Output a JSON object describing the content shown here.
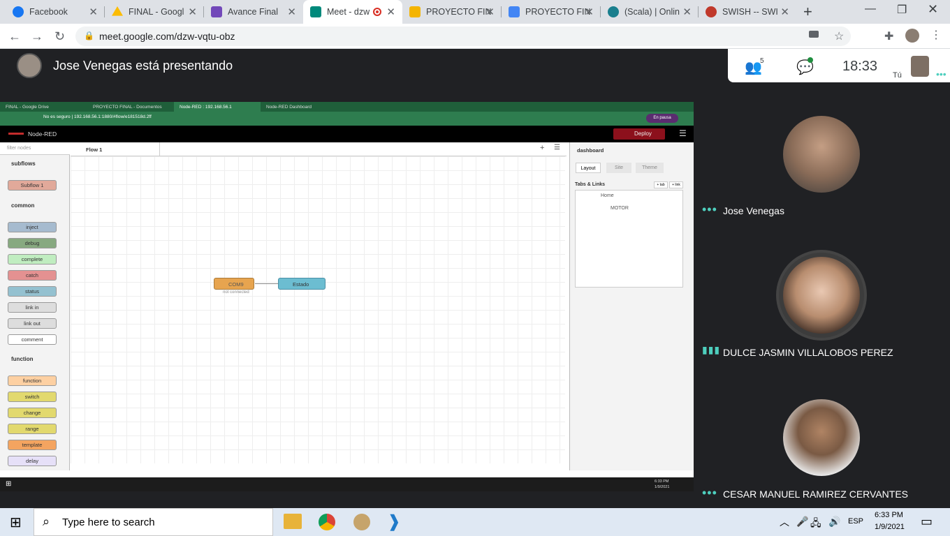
{
  "browser": {
    "tabs": [
      {
        "title": "Facebook",
        "color": "#1877f2"
      },
      {
        "title": "FINAL - Googl",
        "color": "#fbbc04"
      },
      {
        "title": "Avance Final",
        "color": "#7248b9"
      },
      {
        "title": "Meet - dzw",
        "color": "#00897b"
      },
      {
        "title": "PROYECTO FIN",
        "color": "#f4b400"
      },
      {
        "title": "PROYECTO FIN",
        "color": "#4285f4"
      },
      {
        "title": "(Scala) | Onlin",
        "color": "#1a7f8e"
      },
      {
        "title": "SWISH -- SWI",
        "color": "#c0392b"
      }
    ],
    "url": "meet.google.com/dzw-vqtu-obz"
  },
  "meet": {
    "presenting_text": "Jose Venegas está presentando",
    "participant_count": "5",
    "time": "18:33",
    "self_label": "Tú",
    "participants": [
      {
        "name": "Jose Venegas"
      },
      {
        "name": "DULCE JASMIN VILLALOBOS PEREZ"
      },
      {
        "name": "CESAR MANUEL RAMIREZ CERVANTES"
      }
    ]
  },
  "shared": {
    "tabs": [
      "FINAL - Google Drive",
      "PROYECTO FINAL - Documentos",
      "Node-RED : 192.168.56.1",
      "Node-RED Dashboard"
    ],
    "address": "No es seguro  |  192.168.56.1:1880/#flow/e181518d.2ff",
    "paused": "En pausa",
    "app_title": "Node-RED",
    "deploy": "Deploy",
    "filter_placeholder": "filter nodes",
    "flow_tab": "Flow 1",
    "categories": {
      "subflows": "subflows",
      "common": "common",
      "function": "function"
    },
    "palette": {
      "subflows": [
        "Subflow 1"
      ],
      "common": [
        "inject",
        "debug",
        "complete",
        "catch",
        "status",
        "link in",
        "link out",
        "comment"
      ],
      "function": [
        "function",
        "switch",
        "change",
        "range",
        "template",
        "delay"
      ]
    },
    "flow_nodes": {
      "com": "COM9",
      "com_status": "not connected",
      "estado": "Estado",
      "estado_badge": "abc"
    },
    "sidebar": {
      "title": "dashboard",
      "tabs": [
        "Layout",
        "Site",
        "Theme"
      ],
      "section": "Tabs & Links",
      "buttons": [
        "+ tab",
        "+ link"
      ],
      "tree": [
        "Home",
        "MOTOR"
      ]
    },
    "clock_time": "6:33 PM",
    "clock_date": "1/9/2021"
  },
  "taskbar": {
    "search_placeholder": "Type here to search",
    "lang": "ESP",
    "time": "6:33 PM",
    "date": "1/9/2021"
  }
}
